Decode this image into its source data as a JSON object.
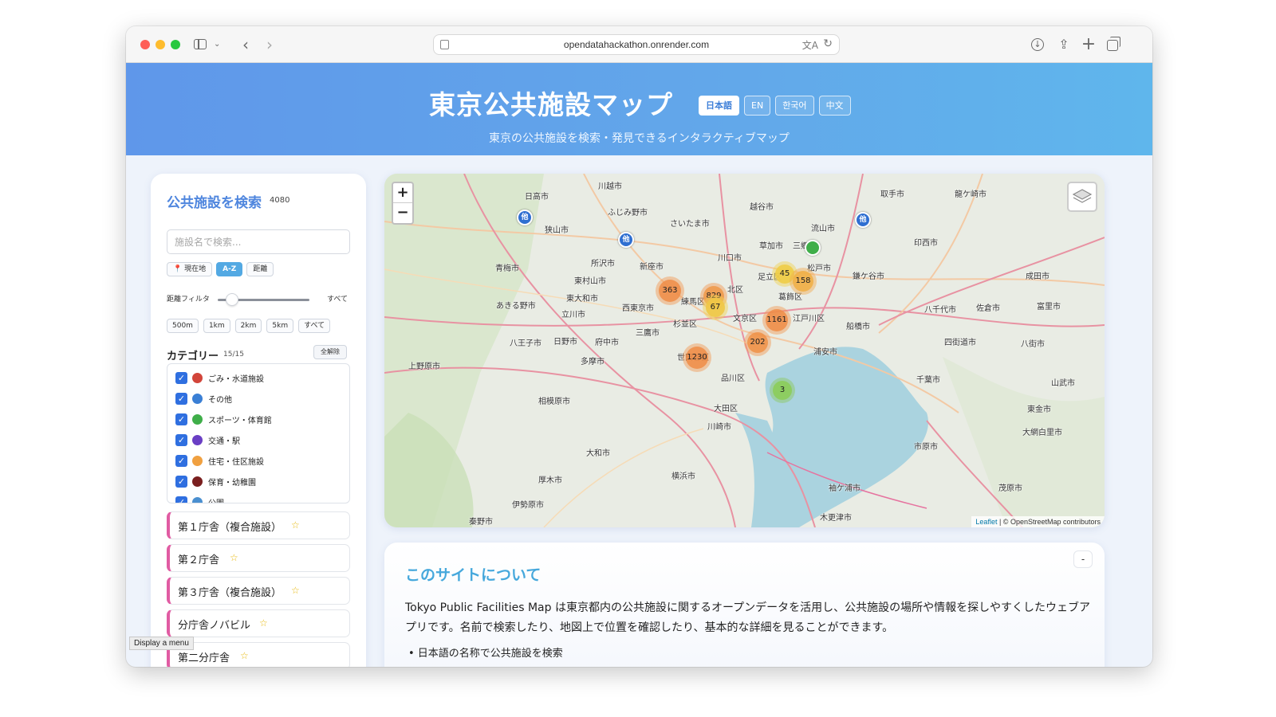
{
  "browser": {
    "url": "opendatahackathon.onrender.com"
  },
  "header": {
    "title": "東京公共施設マップ",
    "subtitle": "東京の公共施設を検索・発見できるインタラクティブマップ",
    "languages": [
      "日本語",
      "EN",
      "한국어",
      "中文"
    ],
    "active_language": "日本語"
  },
  "sidebar": {
    "title": "公共施設を検索",
    "count": "4080",
    "search_placeholder": "施設名で検索...",
    "sort_buttons": [
      "📍 現在地",
      "A-Z",
      "距離"
    ],
    "active_sort": "A-Z",
    "distance_filter_label": "距離フィルタ",
    "distance_filter_value": "すべて",
    "distance_buttons": [
      "500m",
      "1km",
      "2km",
      "5km",
      "すべて"
    ],
    "category_title": "カテゴリー",
    "category_count": "15/15",
    "clear_all": "全解除",
    "categories": [
      {
        "label": "ごみ・水道施設",
        "color": "#d2453a",
        "checked": true
      },
      {
        "label": "その他",
        "color": "#3a7fd5",
        "checked": true
      },
      {
        "label": "スポーツ・体育館",
        "color": "#3fae49",
        "checked": true
      },
      {
        "label": "交通・駅",
        "color": "#6a3fc4",
        "checked": true
      },
      {
        "label": "住宅・住区施設",
        "color": "#f0a040",
        "checked": true
      },
      {
        "label": "保育・幼稚園",
        "color": "#7a1f1f",
        "checked": true
      },
      {
        "label": "公園",
        "color": "#4a8fd0",
        "checked": true
      }
    ],
    "facilities": [
      {
        "name": "第１庁舎（複合施設）",
        "star": "☆"
      },
      {
        "name": "第２庁舎",
        "star": "☆"
      },
      {
        "name": "第３庁舎（複合施設）",
        "star": "☆"
      },
      {
        "name": "分庁舎ノバビル",
        "star": "☆"
      },
      {
        "name": "第二分庁舎",
        "star": "☆"
      }
    ],
    "tooltip": "Display a menu"
  },
  "map": {
    "zoom_in": "+",
    "zoom_out": "−",
    "labels": [
      "日高市",
      "川越市",
      "ふじみ野市",
      "さいたま市",
      "越谷市",
      "流山市",
      "取手市",
      "龍ケ崎市",
      "狭山市",
      "所沢市",
      "新座市",
      "川口市",
      "草加市",
      "三郷市",
      "松戸市",
      "鎌ケ谷市",
      "印西市",
      "青梅市",
      "東村山市",
      "北区",
      "足立区",
      "葛飾区",
      "成田市",
      "あきる野市",
      "東大和市",
      "西東京市",
      "練馬区",
      "八千代市",
      "佐倉市",
      "富里市",
      "立川市",
      "杉並区",
      "文京区",
      "江戸川区",
      "船橋市",
      "八王子市",
      "日野市",
      "府中市",
      "三鷹市",
      "四街道市",
      "八街市",
      "多摩市",
      "世田谷区",
      "浦安市",
      "上野原市",
      "品川区",
      "千葉市",
      "山武市",
      "相模原市",
      "大田区",
      "東金市",
      "川崎市",
      "大網白里市",
      "大和市",
      "横浜市",
      "市原市",
      "厚木市",
      "袖ケ浦市",
      "茂原市",
      "伊勢原市",
      "秦野市",
      "木更津市"
    ],
    "clusters": [
      "363",
      "829",
      "67",
      "45",
      "158",
      "1161",
      "202",
      "1230",
      "3"
    ],
    "pin_label": "他",
    "attribution_leaflet": "Leaflet",
    "attribution_osm": "| © OpenStreetMap contributors"
  },
  "about": {
    "title": "このサイトについて",
    "toggle": "-",
    "body": "Tokyo Public Facilities Map は東京都内の公共施設に関するオープンデータを活用し、公共施設の場所や情報を探しやすくしたウェブアプリです。名前で検索したり、地図上で位置を確認したり、基本的な詳細を見ることができます。",
    "bullet": "• 日本語の名称で公共施設を検索"
  }
}
